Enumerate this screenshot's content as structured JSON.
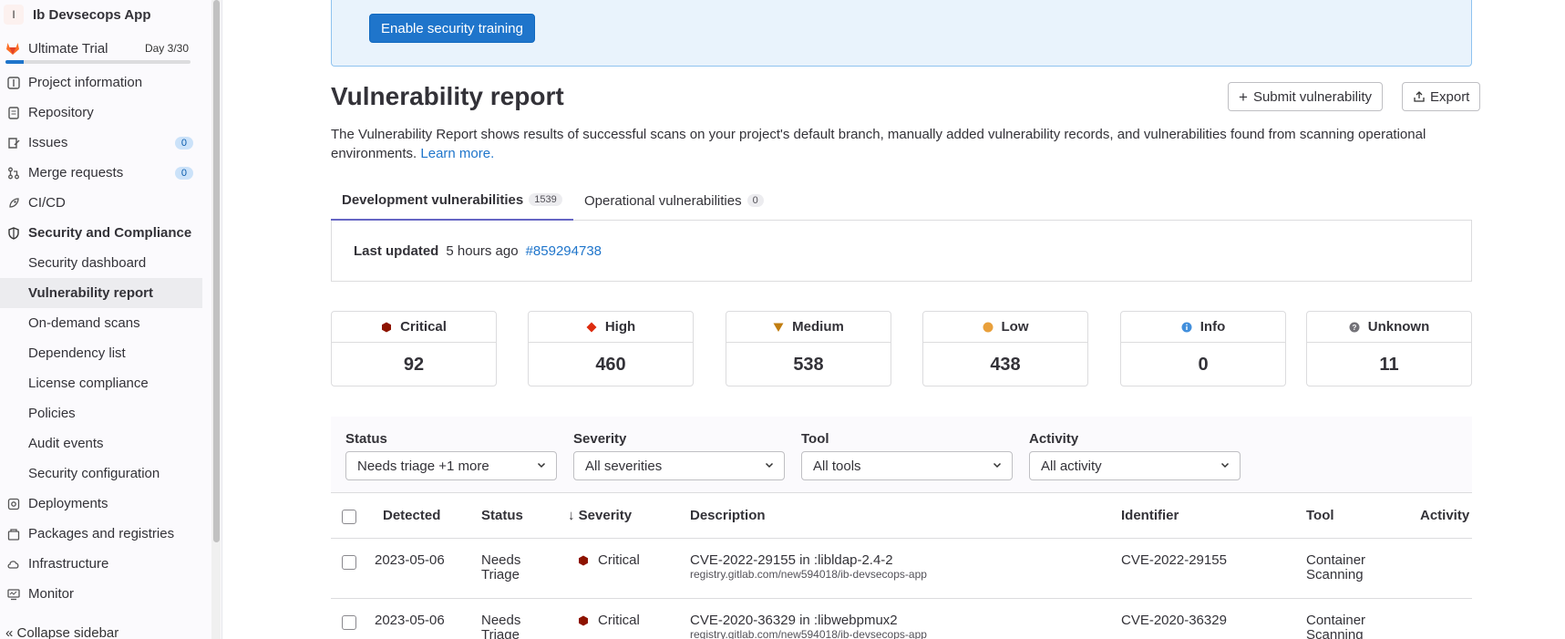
{
  "sidebar": {
    "project_initial": "I",
    "project_name": "Ib Devsecops App",
    "trial_label": "Ultimate Trial",
    "trial_day": "Day 3/30",
    "trial_progress": 0.1,
    "items": [
      {
        "label": "Project information",
        "icon": "info-icon"
      },
      {
        "label": "Repository",
        "icon": "doc-icon"
      },
      {
        "label": "Issues",
        "icon": "issues-icon",
        "badge": "0"
      },
      {
        "label": "Merge requests",
        "icon": "merge-request-icon",
        "badge": "0"
      },
      {
        "label": "CI/CD",
        "icon": "rocket-icon"
      },
      {
        "label": "Security and Compliance",
        "icon": "shield-icon"
      }
    ],
    "sub_items": [
      "Security dashboard",
      "Vulnerability report",
      "On-demand scans",
      "Dependency list",
      "License compliance",
      "Policies",
      "Audit events",
      "Security configuration"
    ],
    "items_after": [
      {
        "label": "Deployments",
        "icon": "deployments-icon"
      },
      {
        "label": "Packages and registries",
        "icon": "package-icon"
      },
      {
        "label": "Infrastructure",
        "icon": "cloud-gear-icon"
      },
      {
        "label": "Monitor",
        "icon": "monitor-icon"
      }
    ],
    "collapse_label": "Collapse sidebar"
  },
  "banner": {
    "button_label": "Enable security training"
  },
  "header": {
    "title": "Vulnerability report",
    "submit_label": "Submit vulnerability",
    "export_label": "Export",
    "description": "The Vulnerability Report shows results of successful scans on your project's default branch, manually added vulnerability records, and vulnerabilities found from scanning operational environments.",
    "learn_more": "Learn more."
  },
  "tabs": [
    {
      "label": "Development vulnerabilities",
      "count": "1539"
    },
    {
      "label": "Operational vulnerabilities",
      "count": "0"
    }
  ],
  "last_updated": {
    "label": "Last updated",
    "time": "5 hours ago",
    "pipeline": "#859294738"
  },
  "severity_cards": [
    {
      "label": "Critical",
      "value": "92",
      "color": "#8d1300"
    },
    {
      "label": "High",
      "value": "460",
      "color": "#dd2b0e"
    },
    {
      "label": "Medium",
      "value": "538",
      "color": "#c17d10"
    },
    {
      "label": "Low",
      "value": "438",
      "color": "#e9a03b"
    },
    {
      "label": "Info",
      "value": "0",
      "color": "#428fdc"
    },
    {
      "label": "Unknown",
      "value": "11",
      "color": "#737278"
    }
  ],
  "filters": [
    {
      "label": "Status",
      "value": "Needs triage +1 more"
    },
    {
      "label": "Severity",
      "value": "All severities"
    },
    {
      "label": "Tool",
      "value": "All tools"
    },
    {
      "label": "Activity",
      "value": "All activity"
    }
  ],
  "table": {
    "columns": [
      "Detected",
      "Status",
      "Severity",
      "Description",
      "Identifier",
      "Tool",
      "Activity"
    ],
    "rows": [
      {
        "detected": "2023-05-06",
        "status_1": "Needs",
        "status_2": "Triage",
        "severity": "Critical",
        "description": "CVE-2022-29155 in :libldap-2.4-2",
        "location": "registry.gitlab.com/new594018/ib-devsecops-app",
        "identifier": "CVE-2022-29155",
        "tool_1": "Container",
        "tool_2": "Scanning"
      },
      {
        "detected": "2023-05-06",
        "status_1": "Needs",
        "status_2": "Triage",
        "severity": "Critical",
        "description": "CVE-2020-36329 in :libwebpmux2",
        "location": "registry.gitlab.com/new594018/ib-devsecops-app",
        "identifier": "CVE-2020-36329",
        "tool_1": "Container",
        "tool_2": "Scanning"
      }
    ]
  }
}
